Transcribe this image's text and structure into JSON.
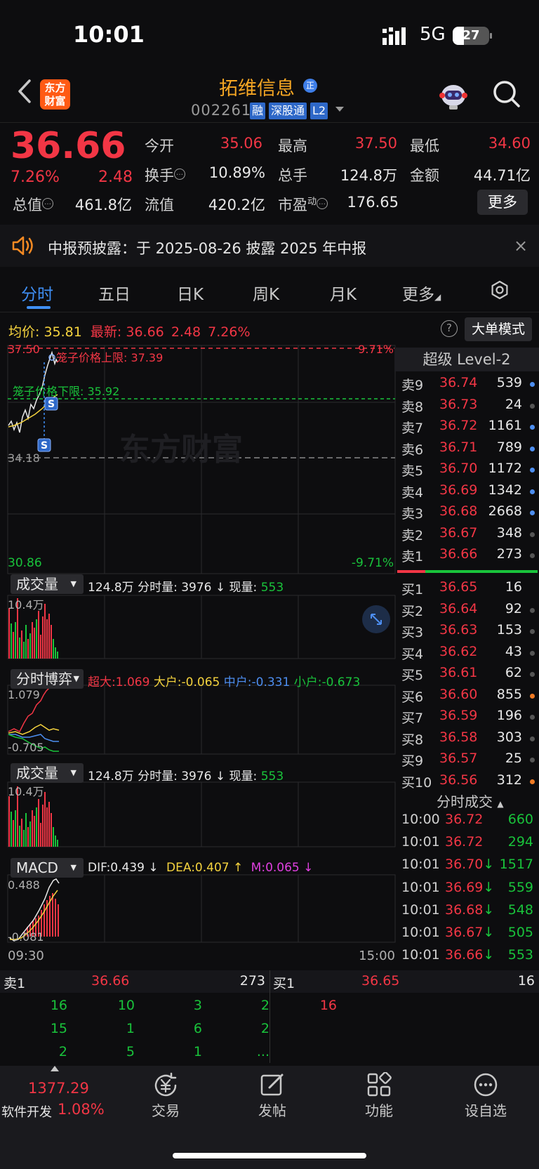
{
  "status": {
    "time": "10:01",
    "network": "5G",
    "battery": "27"
  },
  "header": {
    "logo_line1": "东方",
    "logo_line2": "财富",
    "name": "拓维信息",
    "name_badge": "正",
    "code": "002261",
    "tags": [
      "融",
      "深股通",
      "L2"
    ]
  },
  "quote": {
    "price": "36.66",
    "pct": "7.26%",
    "change": "2.48",
    "fields": [
      {
        "label": "今开",
        "value": "35.06",
        "color": "red"
      },
      {
        "label": "最高",
        "value": "37.50",
        "color": "red"
      },
      {
        "label": "最低",
        "value": "34.60",
        "color": "red"
      },
      {
        "label": "换手",
        "value": "10.89%",
        "color": "white"
      },
      {
        "label": "总手",
        "value": "124.8万",
        "color": "white"
      },
      {
        "label": "金额",
        "value": "44.71亿",
        "color": "white"
      },
      {
        "label": "总值",
        "value": "461.8亿",
        "color": "white"
      },
      {
        "label": "流值",
        "value": "420.2亿",
        "color": "white"
      },
      {
        "label": "市盈",
        "value": "176.65",
        "color": "white"
      }
    ],
    "pe_sup": "动",
    "more": "更多"
  },
  "announcement": {
    "text": "中报预披露：于 2025-08-26 披露 2025 年中报",
    "close": "×"
  },
  "tabs": [
    "分时",
    "五日",
    "日K",
    "周K",
    "月K",
    "更多"
  ],
  "avg_row": {
    "avg_label": "均价:",
    "avg": "35.81",
    "latest_label": "最新:",
    "latest": "36.66",
    "chg": "2.48",
    "pct": "7.26%"
  },
  "dadan": "大单模式",
  "chart": {
    "top_price": "37.50",
    "top_pct": "9.71%",
    "mid_price": "34.18",
    "bottom_price": "30.86",
    "bottom_pct": "-9.71%",
    "upper_limit": "笼子价格上限: 37.39",
    "lower_limit": "笼子价格下限: 35.92",
    "watermark": "东方财富",
    "s_mark": "S",
    "start_time": "09:30",
    "end_time": "15:00"
  },
  "vol1": {
    "tag": "成交量",
    "total": "124.8万",
    "fs_label": "分时量:",
    "fs": "3976",
    "xl_label": "现量:",
    "xl": "553",
    "max": "10.4万"
  },
  "boyi": {
    "tag": "分时博弈",
    "cd_label": "超大:",
    "cd": "1.069",
    "dh_label": "大户:",
    "dh": "-0.065",
    "zh_label": "中户:",
    "zh": "-0.331",
    "xh_label": "小户:",
    "xh": "-0.673",
    "max": "1.079",
    "min": "-0.705"
  },
  "vol2": {
    "tag": "成交量",
    "total": "124.8万",
    "fs_label": "分时量:",
    "fs": "3976",
    "xl_label": "现量:",
    "xl": "553",
    "max": "10.4万"
  },
  "macd": {
    "tag": "MACD",
    "dif_label": "DIF:",
    "dif": "0.439",
    "dea_label": "DEA:",
    "dea": "0.407",
    "m_label": "M:",
    "m": "0.065",
    "max": "0.488",
    "min": "-0.081"
  },
  "level2": {
    "title": "超级 Level-2",
    "asks": [
      {
        "label": "卖9",
        "price": "36.74",
        "vol": "539",
        "dot": "blue"
      },
      {
        "label": "卖8",
        "price": "36.73",
        "vol": "24",
        "dot": "gray"
      },
      {
        "label": "卖7",
        "price": "36.72",
        "vol": "1161",
        "dot": "blue"
      },
      {
        "label": "卖6",
        "price": "36.71",
        "vol": "789",
        "dot": "blue"
      },
      {
        "label": "卖5",
        "price": "36.70",
        "vol": "1172",
        "dot": "blue"
      },
      {
        "label": "卖4",
        "price": "36.69",
        "vol": "1342",
        "dot": "blue"
      },
      {
        "label": "卖3",
        "price": "36.68",
        "vol": "2668",
        "dot": "blue"
      },
      {
        "label": "卖2",
        "price": "36.67",
        "vol": "348",
        "dot": "gray"
      },
      {
        "label": "卖1",
        "price": "36.66",
        "vol": "273",
        "dot": "gray"
      }
    ],
    "bids": [
      {
        "label": "买1",
        "price": "36.65",
        "vol": "16",
        "dot": ""
      },
      {
        "label": "买2",
        "price": "36.64",
        "vol": "92",
        "dot": "gray"
      },
      {
        "label": "买3",
        "price": "36.63",
        "vol": "153",
        "dot": "gray"
      },
      {
        "label": "买4",
        "price": "36.62",
        "vol": "43",
        "dot": "gray"
      },
      {
        "label": "买5",
        "price": "36.61",
        "vol": "62",
        "dot": "gray"
      },
      {
        "label": "买6",
        "price": "36.60",
        "vol": "855",
        "dot": "orange"
      },
      {
        "label": "买7",
        "price": "36.59",
        "vol": "196",
        "dot": "gray"
      },
      {
        "label": "买8",
        "price": "36.58",
        "vol": "303",
        "dot": "gray"
      },
      {
        "label": "买9",
        "price": "36.57",
        "vol": "25",
        "dot": "gray"
      },
      {
        "label": "买10",
        "price": "36.56",
        "vol": "312",
        "dot": "orange"
      }
    ],
    "trades_title": "分时成交",
    "trades": [
      {
        "time": "10:00",
        "price": "36.72",
        "vol": "660",
        "arrow": ""
      },
      {
        "time": "10:01",
        "price": "36.72",
        "vol": "294",
        "arrow": ""
      },
      {
        "time": "10:01",
        "price": "36.70",
        "vol": "1517",
        "arrow": "↓"
      },
      {
        "time": "10:01",
        "price": "36.69",
        "vol": "559",
        "arrow": "↓"
      },
      {
        "time": "10:01",
        "price": "36.68",
        "vol": "548",
        "arrow": "↓"
      },
      {
        "time": "10:01",
        "price": "36.67",
        "vol": "505",
        "arrow": "↓"
      },
      {
        "time": "10:01",
        "price": "36.66",
        "vol": "553",
        "arrow": "↓"
      }
    ]
  },
  "queue": {
    "sell_label": "卖1",
    "sell_price": "36.66",
    "sell_vol": "273",
    "buy_label": "买1",
    "buy_price": "36.65",
    "buy_vol": "16",
    "sell_cells": [
      "16",
      "10",
      "3",
      "2",
      "15",
      "1",
      "6",
      "2",
      "2",
      "5",
      "1",
      "..."
    ],
    "buy_cells": [
      "16"
    ]
  },
  "nav": {
    "index_value": "1377.29",
    "index_name": "软件开发",
    "index_pct": "1.08%",
    "items": [
      "交易",
      "发帖",
      "功能",
      "设自选"
    ]
  },
  "colors": {
    "up": "#f23645",
    "down": "#19c33b",
    "accent": "#3f8ff5",
    "avg": "#f5d33e"
  }
}
